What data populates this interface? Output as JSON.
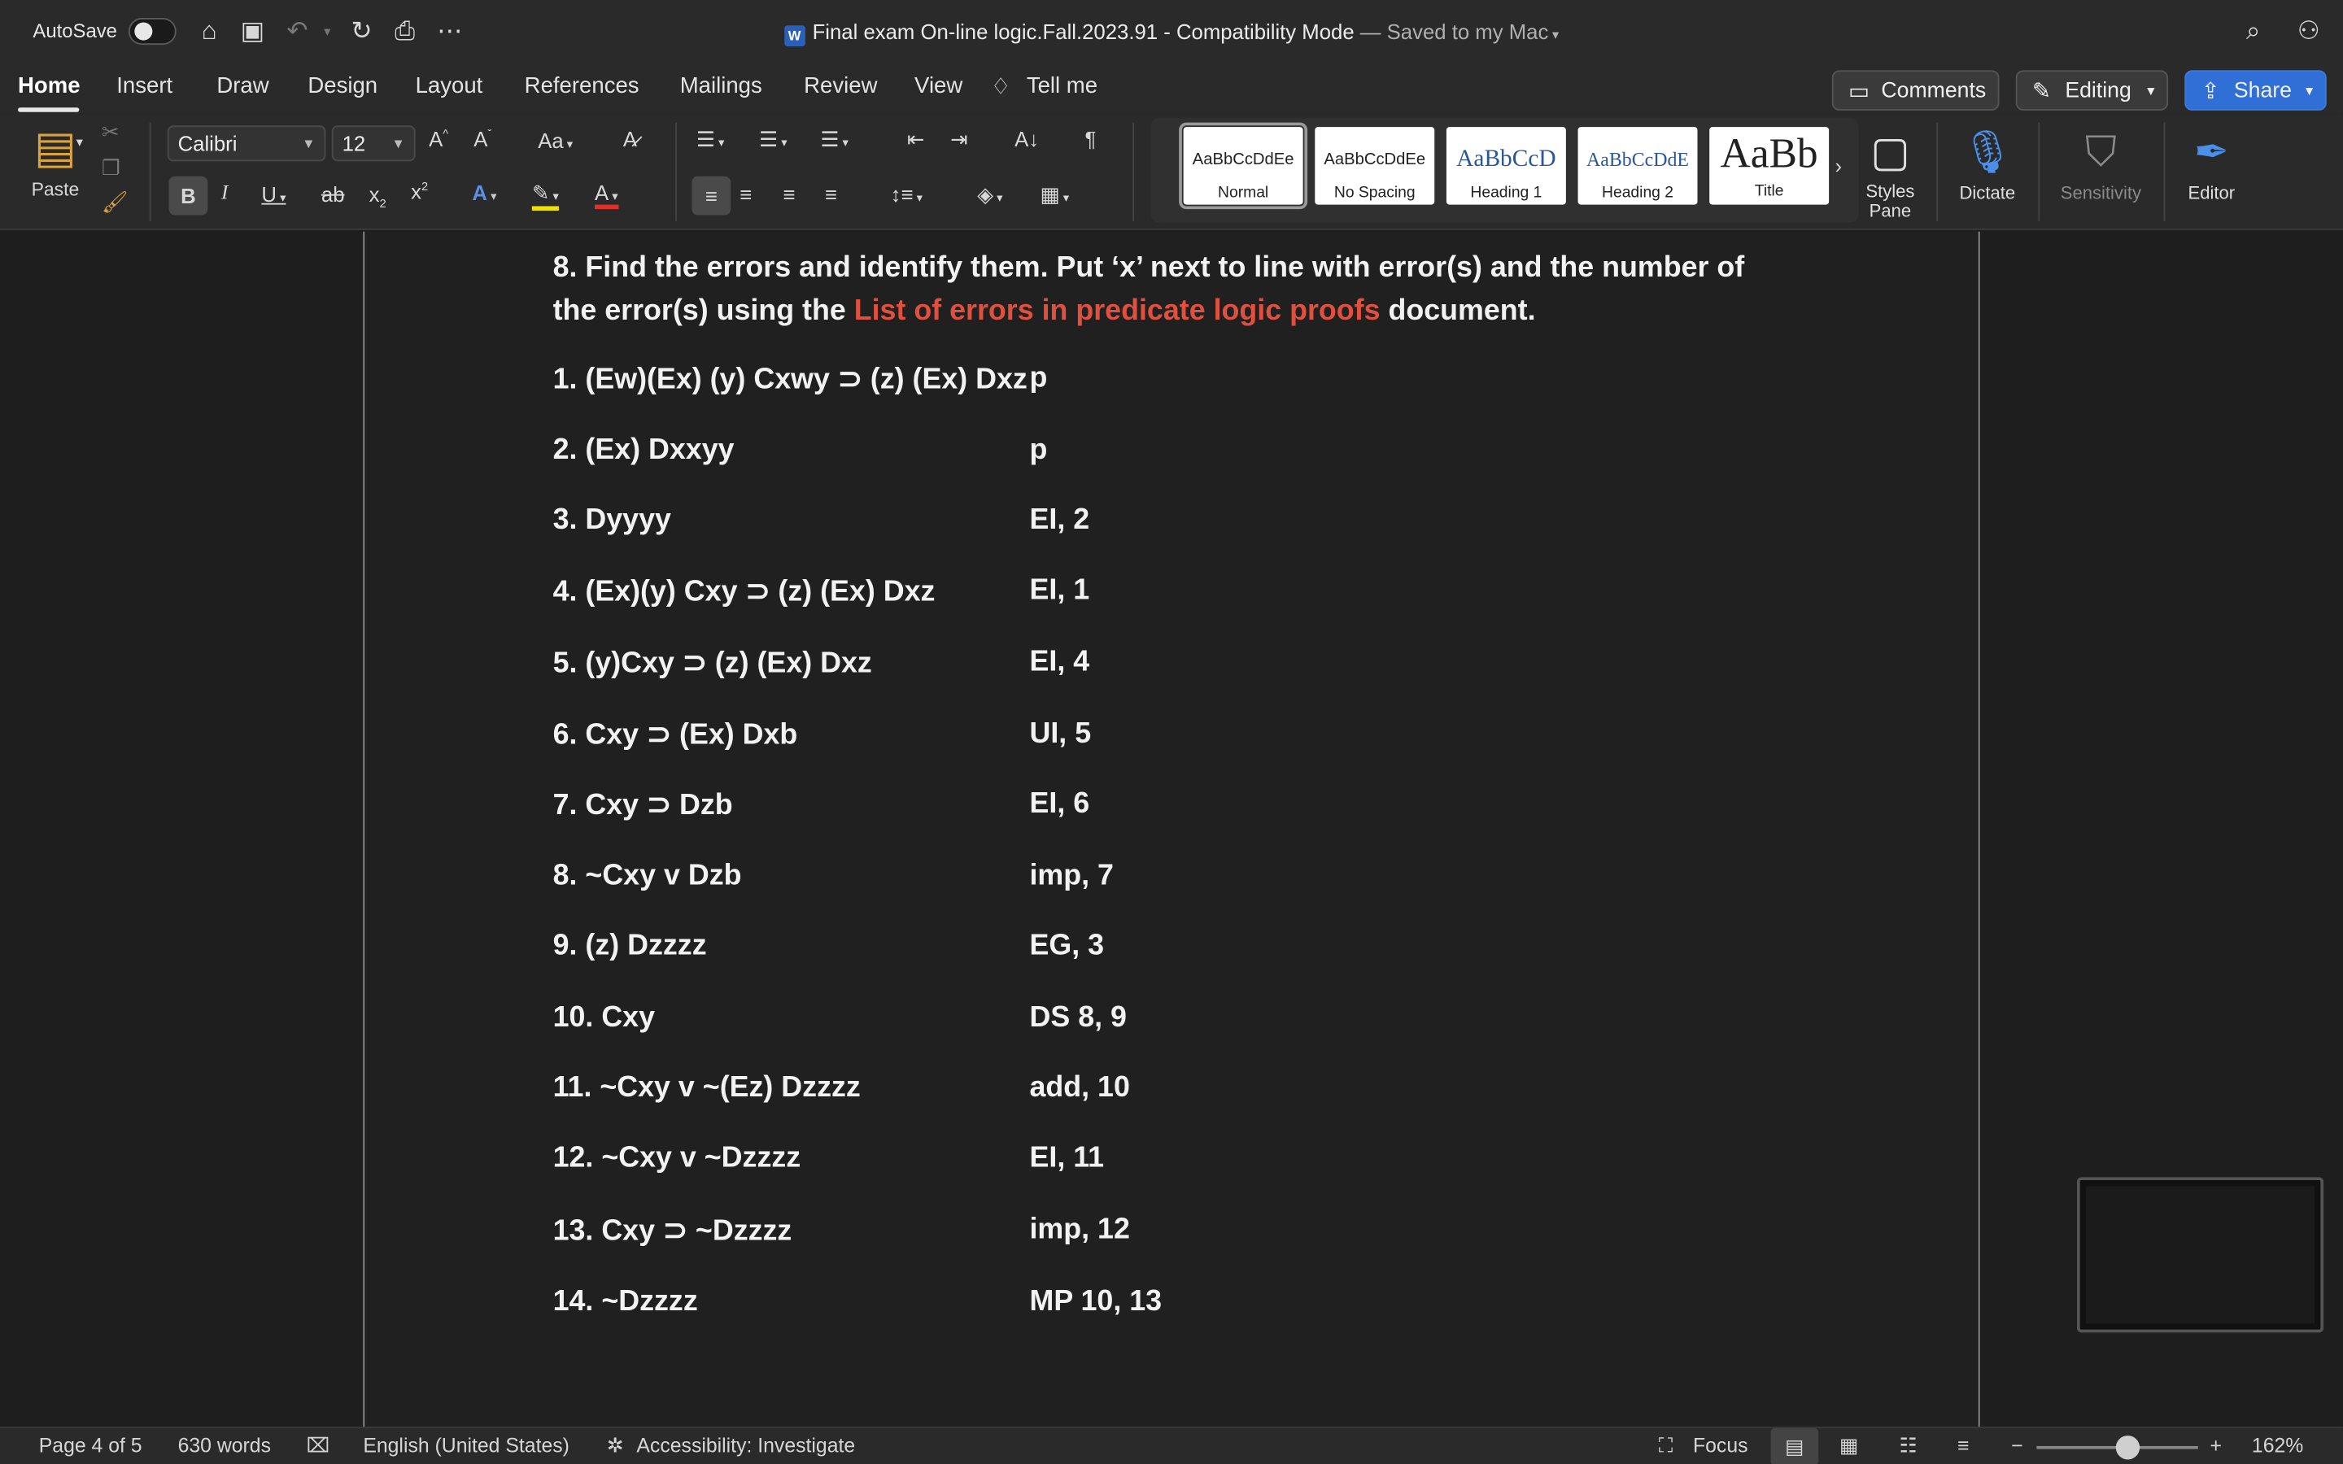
{
  "window": {
    "autosave_label": "AutoSave",
    "title": "Final exam On-line logic.Fall.2023.91",
    "title_sep": " - ",
    "mode": "Compatibility Mode",
    "saved": "— Saved to my Mac"
  },
  "tabs": [
    "Home",
    "Insert",
    "Draw",
    "Design",
    "Layout",
    "References",
    "Mailings",
    "Review",
    "View"
  ],
  "tell_me": "Tell me",
  "actions": {
    "comments": "Comments",
    "editing": "Editing",
    "share": "Share"
  },
  "ribbon": {
    "paste": "Paste",
    "font_name": "Calibri",
    "font_size": "12",
    "styles": [
      {
        "sample": "AaBbCcDdEe",
        "name": "Normal"
      },
      {
        "sample": "AaBbCcDdEe",
        "name": "No Spacing"
      },
      {
        "sample": "AaBbCcD",
        "name": "Heading 1"
      },
      {
        "sample": "AaBbCcDdE",
        "name": "Heading 2"
      },
      {
        "sample": "AaBb",
        "name": "Title"
      }
    ],
    "styles_pane": "Styles Pane",
    "dictate": "Dictate",
    "sensitivity": "Sensitivity",
    "editor": "Editor"
  },
  "document": {
    "question_prefix": "8. Find the errors and identify them. Put ‘x’ next to line with error(s) and the number of the error(s) using the ",
    "question_link": "List of errors in predicate logic proofs",
    "question_suffix": " document.",
    "lines": [
      {
        "stmt": "1. (Ew)(Ex) (y) Cxwy ⊃ (z) (Ex) Dxz",
        "just": "p"
      },
      {
        "stmt": "2. (Ex) Dxxyy",
        "just": "p"
      },
      {
        "stmt": "3. Dyyyy",
        "just": "EI, 2"
      },
      {
        "stmt": "4. (Ex)(y) Cxy ⊃ (z) (Ex) Dxz",
        "just": "EI, 1"
      },
      {
        "stmt": "5. (y)Cxy ⊃ (z) (Ex) Dxz",
        "just": "EI, 4"
      },
      {
        "stmt": "6. Cxy ⊃ (Ex) Dxb",
        "just": "UI, 5"
      },
      {
        "stmt": "7. Cxy  ⊃ Dzb",
        "just": "EI, 6"
      },
      {
        "stmt": "8. ~Cxy v Dzb",
        "just": "imp, 7"
      },
      {
        "stmt": "9. (z) Dzzzz",
        "just": "EG, 3"
      },
      {
        "stmt": "10. Cxy",
        "just": "DS 8, 9"
      },
      {
        "stmt": "11. ~Cxy v ~(Ez) Dzzzz",
        "just": "add, 10"
      },
      {
        "stmt": "12. ~Cxy v ~Dzzzz",
        "just": "EI, 11"
      },
      {
        "stmt": "13. Cxy ⊃ ~Dzzzz",
        "just": "imp, 12"
      },
      {
        "stmt": "14. ~Dzzzz",
        "just": "MP 10, 13"
      }
    ]
  },
  "status": {
    "page": "Page 4 of 5",
    "words": "630 words",
    "language": "English (United States)",
    "accessibility": "Accessibility: Investigate",
    "focus": "Focus",
    "zoom": "162%"
  }
}
